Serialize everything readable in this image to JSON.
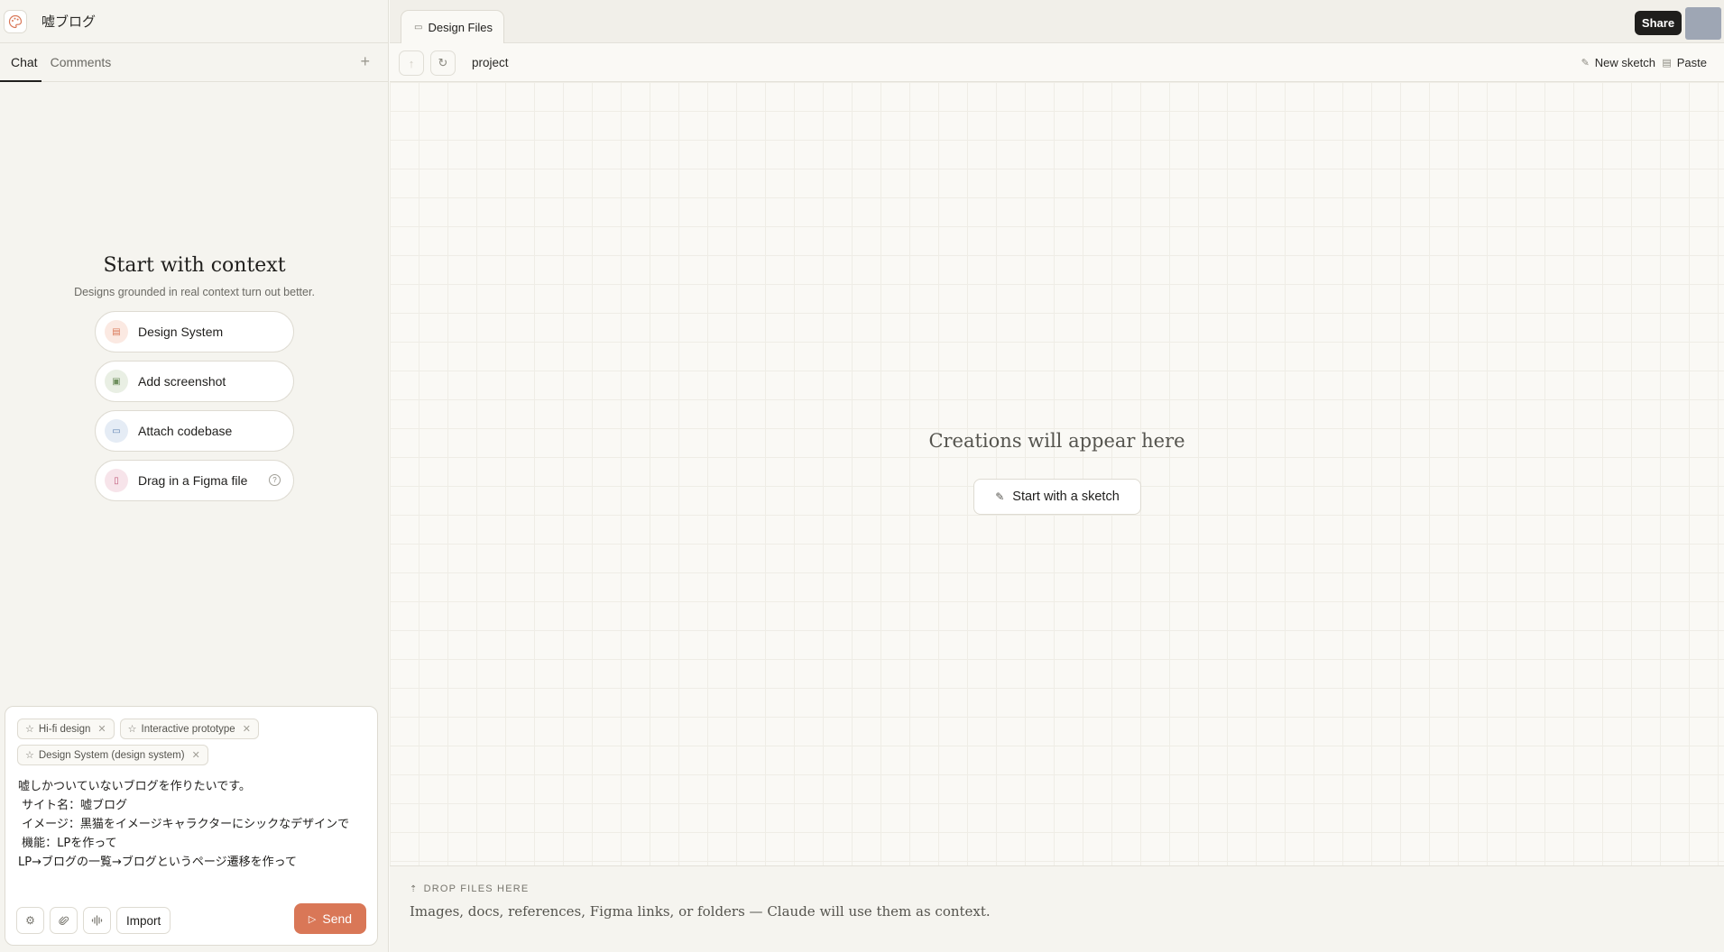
{
  "project": {
    "name": "嘘ブログ"
  },
  "chat_tabs": {
    "chat": "Chat",
    "comments": "Comments",
    "add": "+"
  },
  "context": {
    "title": "Start with context",
    "subtitle": "Designs grounded in real context turn out better.",
    "items": [
      {
        "label": "Design System",
        "icon": "design-system-icon",
        "color": "#d97757"
      },
      {
        "label": "Add screenshot",
        "icon": "image-icon",
        "color": "#6f8f5e"
      },
      {
        "label": "Attach codebase",
        "icon": "folder-icon",
        "color": "#5b7fb0"
      },
      {
        "label": "Drag in a Figma file",
        "icon": "figma-file-icon",
        "color": "#c25a7a"
      }
    ]
  },
  "composer": {
    "chips": [
      "Hi-fi design",
      "Interactive prototype",
      "Design System (design system)"
    ],
    "prompt": "嘘しかついていないブログを作りたいです。\n サイト名：嘘ブログ\n イメージ：黒猫をイメージキャラクターにシックなデザインで\n 機能：LPを作って\nLP→ブログの一覧→ブログというページ遷移を作って",
    "import_label": "Import",
    "send_label": "Send",
    "send_color": "#d97757"
  },
  "files": {
    "tab_label": "Design Files",
    "share_label": "Share",
    "breadcrumb": "project",
    "new_sketch": "New sketch",
    "paste": "Paste"
  },
  "canvas": {
    "empty_title": "Creations will appear here",
    "sketch_button": "Start with a sketch"
  },
  "dropzone": {
    "heading": "DROP FILES HERE",
    "text": "Images, docs, references, Figma links, or folders — Claude will use them as context."
  }
}
